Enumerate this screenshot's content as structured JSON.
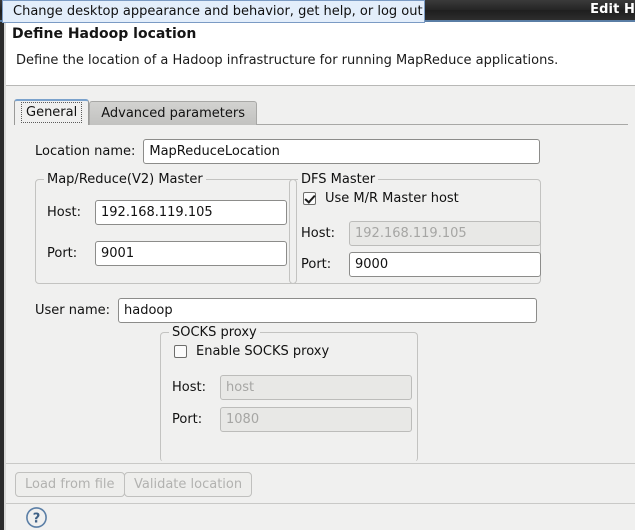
{
  "desktop": {
    "menu_title": "Edit H",
    "tooltip": "Change desktop appearance and behavior, get help, or log out"
  },
  "dialog": {
    "title": "Define Hadoop location",
    "description": "Define the location of a Hadoop infrastructure for running MapReduce applications.",
    "tabs": [
      {
        "label": "General",
        "active": true
      },
      {
        "label": "Advanced parameters",
        "active": false
      }
    ],
    "location_name": {
      "label": "Location name:",
      "value": "MapReduceLocation"
    },
    "mr_master": {
      "title": "Map/Reduce(V2) Master",
      "host_label": "Host:",
      "host_value": "192.168.119.105",
      "port_label": "Port:",
      "port_value": "9001"
    },
    "dfs_master": {
      "title": "DFS Master",
      "use_mr_host_label": "Use M/R Master host",
      "use_mr_host_checked": true,
      "host_label": "Host:",
      "host_value": "192.168.119.105",
      "host_disabled": true,
      "port_label": "Port:",
      "port_value": "9000"
    },
    "user_name": {
      "label": "User name:",
      "value": "hadoop"
    },
    "socks_proxy": {
      "title": "SOCKS proxy",
      "enable_label": "Enable SOCKS proxy",
      "enable_checked": false,
      "host_label": "Host:",
      "host_placeholder": "host",
      "port_label": "Port:",
      "port_placeholder": "1080"
    },
    "buttons": {
      "load_from_file": "Load from file",
      "validate_location": "Validate location"
    },
    "help_icon": "help-question-circle-icon"
  },
  "colors": {
    "panel_bg": "#f0f0ef",
    "tooltip_bg": "#e3eefb",
    "tooltip_border": "#7b9bc4",
    "accent_tab_top": "#7ba2cc",
    "help_blue": "#5b7fa6",
    "disabled_text": "#a6a6a4"
  }
}
